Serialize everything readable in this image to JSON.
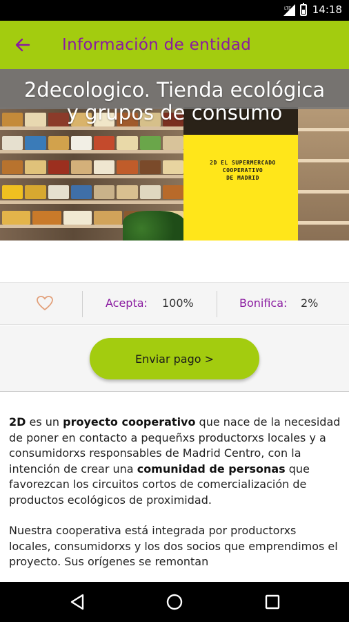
{
  "status_bar": {
    "time": "14:18",
    "network": "LTE",
    "icons": [
      "lte-signal-icon",
      "battery-icon"
    ]
  },
  "app_bar": {
    "back_icon": "arrow-left-icon",
    "title": "Información de entidad"
  },
  "hero": {
    "title_line1": "2decologico. Tienda ecológica",
    "title_line2": "y grupos de consumo",
    "poster_text": "2D EL SUPERMERCADO\nCOOPERATIVO\nDE MADRID"
  },
  "stats": {
    "favorite_icon": "heart-outline-icon",
    "acepta_label": "Acepta:",
    "acepta_value": "100%",
    "bonifica_label": "Bonifica:",
    "bonifica_value": "2%"
  },
  "actions": {
    "pay_label": "Enviar pago >"
  },
  "description": {
    "p1_a": "2D",
    "p1_b": " es un ",
    "p1_c": "proyecto cooperativo",
    "p1_d": " que nace de la necesidad de poner en contacto a pequeñxs productorxs locales y a consumidorxs responsables de Madrid Centro, con la intención de crear una ",
    "p1_e": "comunidad de personas",
    "p1_f": " que favorezcan los circuitos cortos de comercialización de productos ecológicos de proximidad.",
    "p2": "Nuestra cooperativa está integrada por productorxs locales, consumidorxs y los dos socios que emprendimos el proyecto. Sus orígenes se remontan"
  },
  "nav_bar": {
    "icons": [
      "back-triangle-icon",
      "home-circle-icon",
      "recents-square-icon"
    ]
  },
  "colors": {
    "accent": "#a3cc0f",
    "brand_purple": "#8a1ba0"
  }
}
